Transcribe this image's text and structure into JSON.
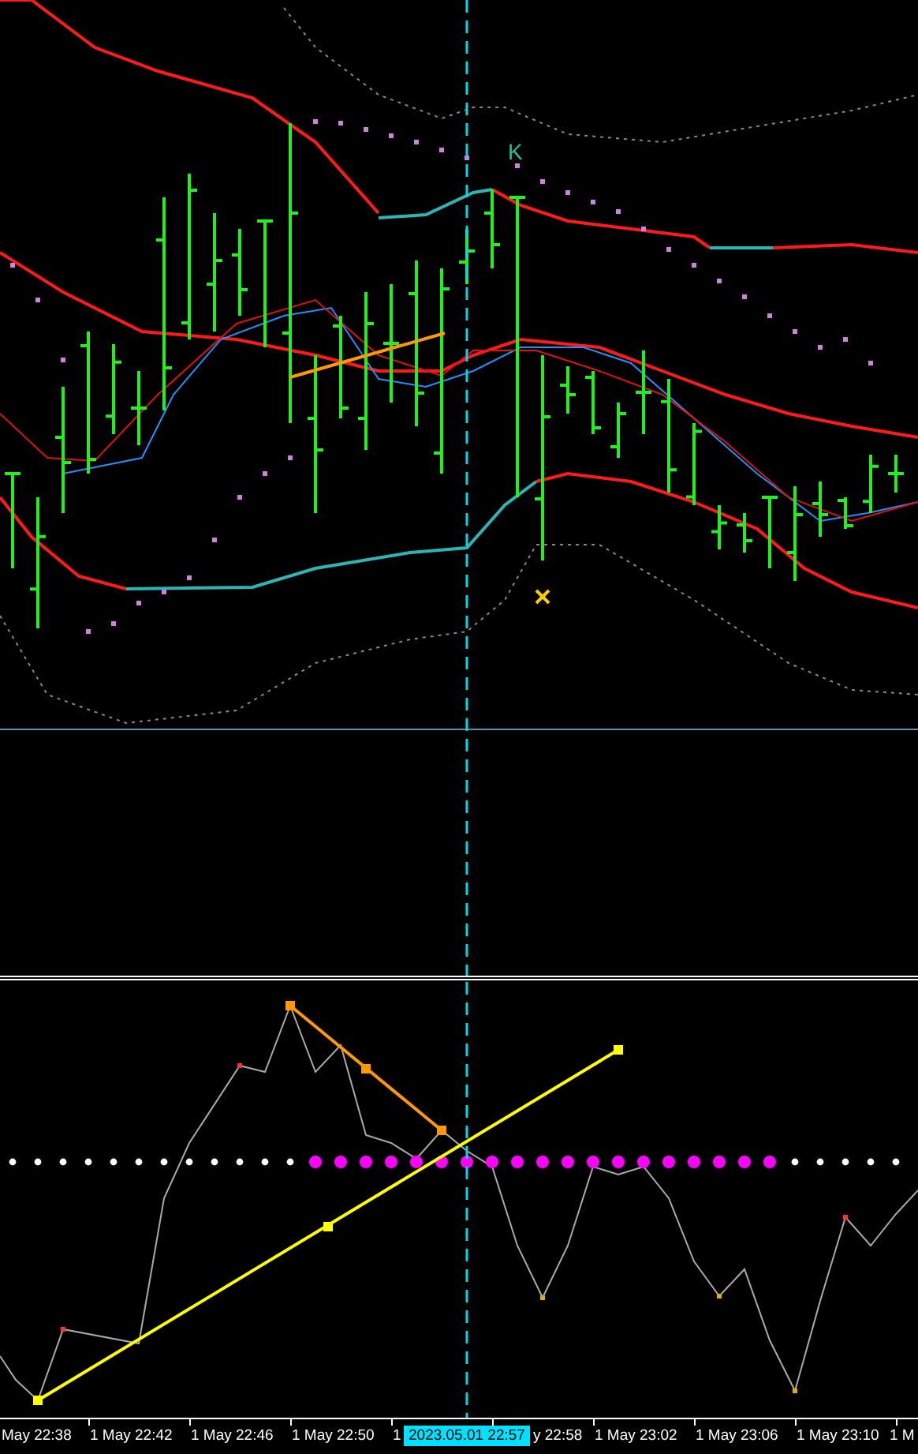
{
  "price_pane": {
    "label": "K"
  },
  "time_axis": {
    "labels": [
      "May 22:38",
      "1 May 22:42",
      "1 May 22:46",
      "1 May 22:50",
      "1",
      "y 22:58",
      "1 May 23:02",
      "1 May 23:06",
      "1 May 23:10",
      "1 M"
    ],
    "crosshair_label": "2023.05.01 22:57"
  }
}
